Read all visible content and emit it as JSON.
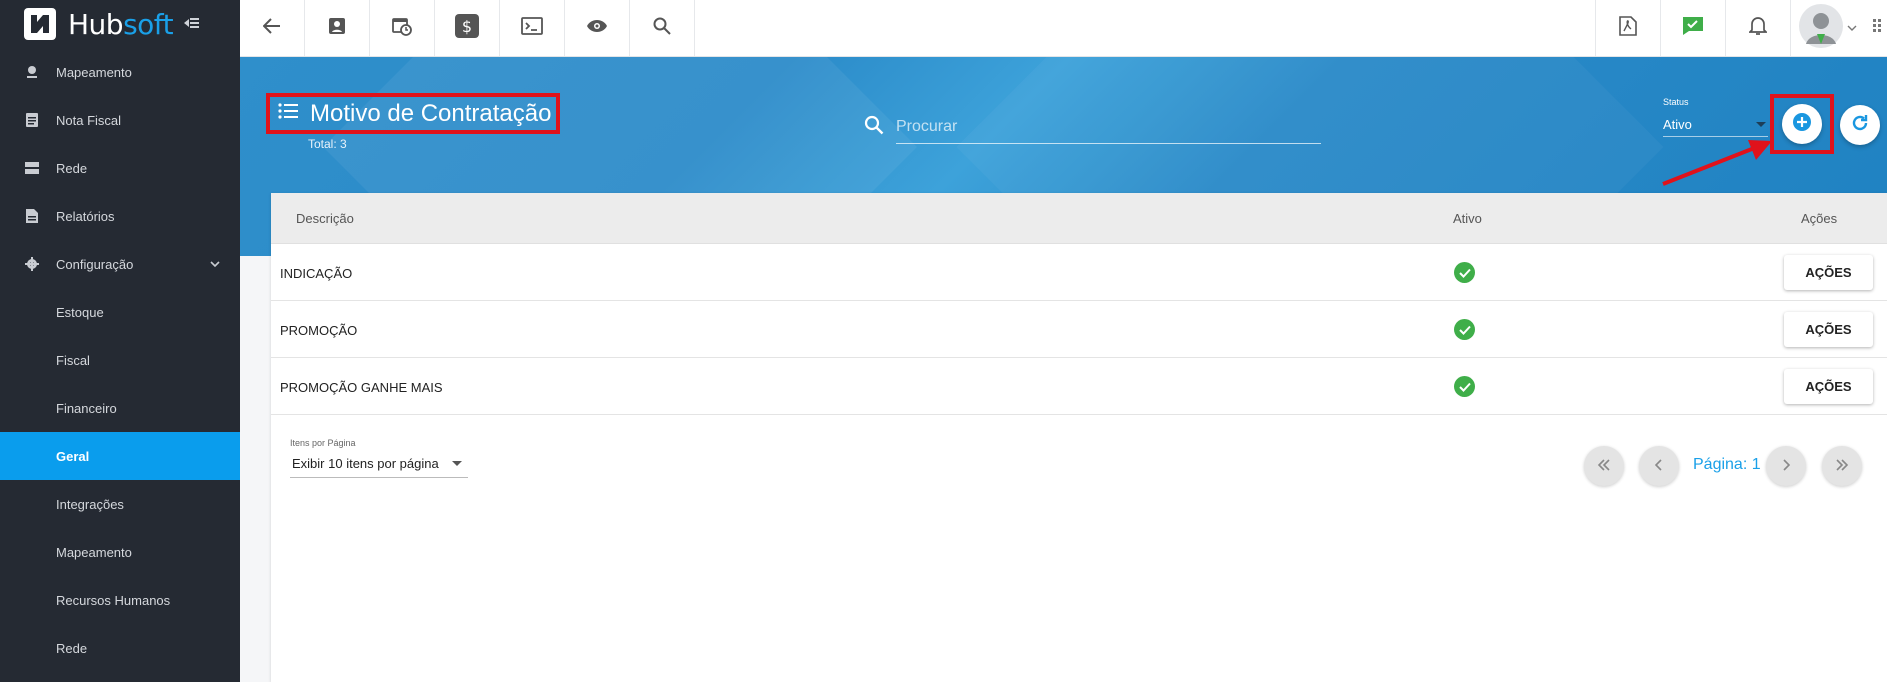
{
  "app": {
    "name_part1": "Hub",
    "name_part2": "soft"
  },
  "sidebar": {
    "items": [
      {
        "label": "Mapeamento",
        "icon": "map-pin-icon"
      },
      {
        "label": "Nota Fiscal",
        "icon": "document-icon"
      },
      {
        "label": "Rede",
        "icon": "server-icon"
      },
      {
        "label": "Relatórios",
        "icon": "report-icon"
      },
      {
        "label": "Configuração",
        "icon": "gear-icon"
      }
    ],
    "subitems": [
      {
        "label": "Estoque"
      },
      {
        "label": "Fiscal"
      },
      {
        "label": "Financeiro"
      },
      {
        "label": "Geral"
      },
      {
        "label": "Integrações"
      },
      {
        "label": "Mapeamento"
      },
      {
        "label": "Recursos Humanos"
      },
      {
        "label": "Rede"
      }
    ]
  },
  "topbar": {
    "icons": [
      "back-arrow-icon",
      "contact-card-icon",
      "calendar-clock-icon",
      "dollar-icon",
      "terminal-icon",
      "eye-icon",
      "search-icon"
    ],
    "right_icons": [
      "pdf-icon",
      "chat-check-icon",
      "bell-icon",
      "avatar-icon"
    ]
  },
  "page": {
    "title": "Motivo de Contratação",
    "total": "Total: 3",
    "search_placeholder": "Procurar",
    "status_label": "Status",
    "status_value": "Ativo"
  },
  "table": {
    "headers": {
      "descricao": "Descrição",
      "ativo": "Ativo",
      "acoes": "Ações"
    },
    "rows": [
      {
        "descricao": "INDICAÇÃO",
        "action": "AÇÕES"
      },
      {
        "descricao": "PROMOÇÃO",
        "action": "AÇÕES"
      },
      {
        "descricao": "PROMOÇÃO GANHE MAIS",
        "action": "AÇÕES"
      }
    ]
  },
  "pagination": {
    "items_label": "Itens por Página",
    "items_value": "Exibir 10 itens por página",
    "page_label": "Página: 1"
  },
  "colors": {
    "accent": "#0a9ded",
    "sidebar_bg": "#252a33",
    "highlight": "#e0121b",
    "check": "#3fae49"
  }
}
